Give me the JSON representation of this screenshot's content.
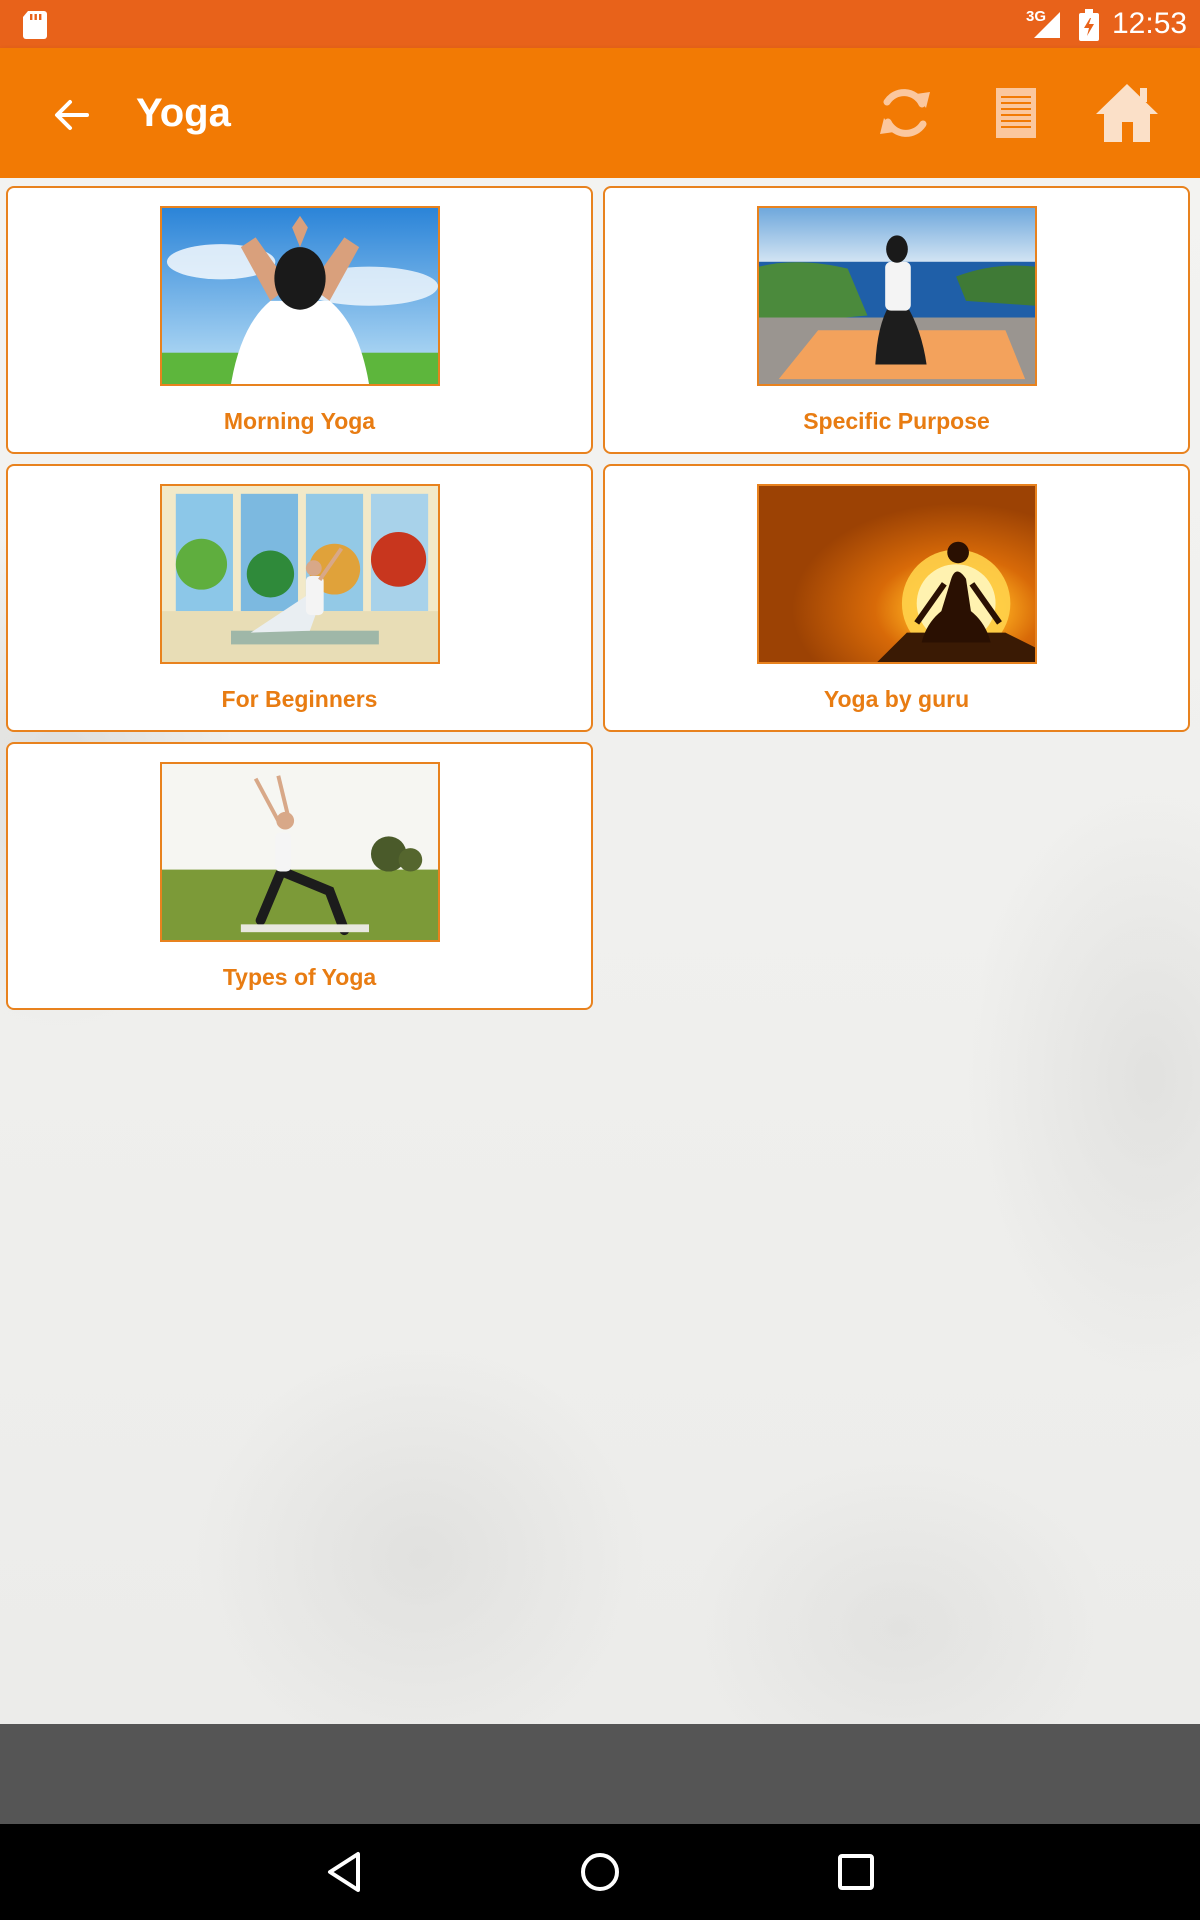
{
  "status_bar": {
    "network_type": "3G",
    "time": "12:53",
    "icons": [
      "sd-card-icon",
      "signal-icon",
      "battery-charging-icon"
    ]
  },
  "app_bar": {
    "title": "Yoga",
    "icons": [
      "back-arrow-icon",
      "refresh-icon",
      "list-icon",
      "home-icon"
    ]
  },
  "categories": [
    {
      "label": "Morning Yoga",
      "image": "woman-meditating-arms-raised-sky"
    },
    {
      "label": "Specific Purpose",
      "image": "woman-kneeling-on-mat-by-sea"
    },
    {
      "label": "For Beginners",
      "image": "woman-stretching-in-window-room"
    },
    {
      "label": "Yoga by guru",
      "image": "silhouette-meditating-at-sunset"
    },
    {
      "label": "Types of Yoga",
      "image": "woman-warrior-pose-on-grass"
    }
  ],
  "nav_bar": {
    "icons": [
      "nav-back-icon",
      "nav-home-icon",
      "nav-recents-icon"
    ]
  },
  "colors": {
    "status_bar": "#e8621a",
    "app_bar": "#f27a04",
    "accent": "#e87c12",
    "bottom_strip": "#555555",
    "nav_bar": "#000000"
  }
}
